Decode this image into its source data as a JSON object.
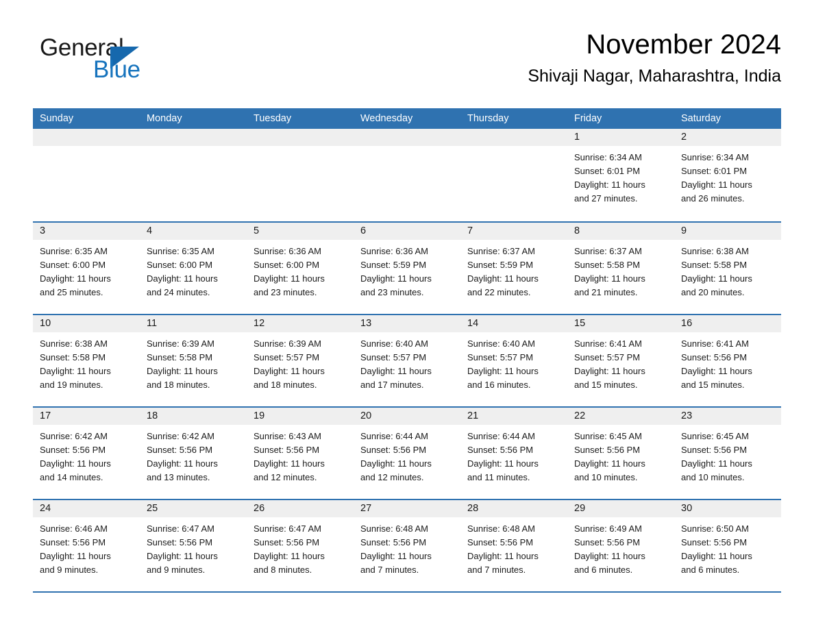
{
  "brand": {
    "name_part1": "General",
    "name_part2": "Blue",
    "accent_color": "#1668ad",
    "triangle_icon": "brand-triangle-icon"
  },
  "header": {
    "month_title": "November 2024",
    "location": "Shivaji Nagar, Maharashtra, India"
  },
  "calendar": {
    "header_bg": "#2f72b0",
    "day_band_bg": "#efefef",
    "weekday_headers": [
      "Sunday",
      "Monday",
      "Tuesday",
      "Wednesday",
      "Thursday",
      "Friday",
      "Saturday"
    ],
    "weeks": [
      [
        {
          "day": "",
          "empty": true,
          "sunrise": "",
          "sunset": "",
          "daylight_1": "",
          "daylight_2": ""
        },
        {
          "day": "",
          "empty": true,
          "sunrise": "",
          "sunset": "",
          "daylight_1": "",
          "daylight_2": ""
        },
        {
          "day": "",
          "empty": true,
          "sunrise": "",
          "sunset": "",
          "daylight_1": "",
          "daylight_2": ""
        },
        {
          "day": "",
          "empty": true,
          "sunrise": "",
          "sunset": "",
          "daylight_1": "",
          "daylight_2": ""
        },
        {
          "day": "",
          "empty": true,
          "sunrise": "",
          "sunset": "",
          "daylight_1": "",
          "daylight_2": ""
        },
        {
          "day": "1",
          "empty": false,
          "sunrise": "Sunrise: 6:34 AM",
          "sunset": "Sunset: 6:01 PM",
          "daylight_1": "Daylight: 11 hours",
          "daylight_2": "and 27 minutes."
        },
        {
          "day": "2",
          "empty": false,
          "sunrise": "Sunrise: 6:34 AM",
          "sunset": "Sunset: 6:01 PM",
          "daylight_1": "Daylight: 11 hours",
          "daylight_2": "and 26 minutes."
        }
      ],
      [
        {
          "day": "3",
          "empty": false,
          "sunrise": "Sunrise: 6:35 AM",
          "sunset": "Sunset: 6:00 PM",
          "daylight_1": "Daylight: 11 hours",
          "daylight_2": "and 25 minutes."
        },
        {
          "day": "4",
          "empty": false,
          "sunrise": "Sunrise: 6:35 AM",
          "sunset": "Sunset: 6:00 PM",
          "daylight_1": "Daylight: 11 hours",
          "daylight_2": "and 24 minutes."
        },
        {
          "day": "5",
          "empty": false,
          "sunrise": "Sunrise: 6:36 AM",
          "sunset": "Sunset: 6:00 PM",
          "daylight_1": "Daylight: 11 hours",
          "daylight_2": "and 23 minutes."
        },
        {
          "day": "6",
          "empty": false,
          "sunrise": "Sunrise: 6:36 AM",
          "sunset": "Sunset: 5:59 PM",
          "daylight_1": "Daylight: 11 hours",
          "daylight_2": "and 23 minutes."
        },
        {
          "day": "7",
          "empty": false,
          "sunrise": "Sunrise: 6:37 AM",
          "sunset": "Sunset: 5:59 PM",
          "daylight_1": "Daylight: 11 hours",
          "daylight_2": "and 22 minutes."
        },
        {
          "day": "8",
          "empty": false,
          "sunrise": "Sunrise: 6:37 AM",
          "sunset": "Sunset: 5:58 PM",
          "daylight_1": "Daylight: 11 hours",
          "daylight_2": "and 21 minutes."
        },
        {
          "day": "9",
          "empty": false,
          "sunrise": "Sunrise: 6:38 AM",
          "sunset": "Sunset: 5:58 PM",
          "daylight_1": "Daylight: 11 hours",
          "daylight_2": "and 20 minutes."
        }
      ],
      [
        {
          "day": "10",
          "empty": false,
          "sunrise": "Sunrise: 6:38 AM",
          "sunset": "Sunset: 5:58 PM",
          "daylight_1": "Daylight: 11 hours",
          "daylight_2": "and 19 minutes."
        },
        {
          "day": "11",
          "empty": false,
          "sunrise": "Sunrise: 6:39 AM",
          "sunset": "Sunset: 5:58 PM",
          "daylight_1": "Daylight: 11 hours",
          "daylight_2": "and 18 minutes."
        },
        {
          "day": "12",
          "empty": false,
          "sunrise": "Sunrise: 6:39 AM",
          "sunset": "Sunset: 5:57 PM",
          "daylight_1": "Daylight: 11 hours",
          "daylight_2": "and 18 minutes."
        },
        {
          "day": "13",
          "empty": false,
          "sunrise": "Sunrise: 6:40 AM",
          "sunset": "Sunset: 5:57 PM",
          "daylight_1": "Daylight: 11 hours",
          "daylight_2": "and 17 minutes."
        },
        {
          "day": "14",
          "empty": false,
          "sunrise": "Sunrise: 6:40 AM",
          "sunset": "Sunset: 5:57 PM",
          "daylight_1": "Daylight: 11 hours",
          "daylight_2": "and 16 minutes."
        },
        {
          "day": "15",
          "empty": false,
          "sunrise": "Sunrise: 6:41 AM",
          "sunset": "Sunset: 5:57 PM",
          "daylight_1": "Daylight: 11 hours",
          "daylight_2": "and 15 minutes."
        },
        {
          "day": "16",
          "empty": false,
          "sunrise": "Sunrise: 6:41 AM",
          "sunset": "Sunset: 5:56 PM",
          "daylight_1": "Daylight: 11 hours",
          "daylight_2": "and 15 minutes."
        }
      ],
      [
        {
          "day": "17",
          "empty": false,
          "sunrise": "Sunrise: 6:42 AM",
          "sunset": "Sunset: 5:56 PM",
          "daylight_1": "Daylight: 11 hours",
          "daylight_2": "and 14 minutes."
        },
        {
          "day": "18",
          "empty": false,
          "sunrise": "Sunrise: 6:42 AM",
          "sunset": "Sunset: 5:56 PM",
          "daylight_1": "Daylight: 11 hours",
          "daylight_2": "and 13 minutes."
        },
        {
          "day": "19",
          "empty": false,
          "sunrise": "Sunrise: 6:43 AM",
          "sunset": "Sunset: 5:56 PM",
          "daylight_1": "Daylight: 11 hours",
          "daylight_2": "and 12 minutes."
        },
        {
          "day": "20",
          "empty": false,
          "sunrise": "Sunrise: 6:44 AM",
          "sunset": "Sunset: 5:56 PM",
          "daylight_1": "Daylight: 11 hours",
          "daylight_2": "and 12 minutes."
        },
        {
          "day": "21",
          "empty": false,
          "sunrise": "Sunrise: 6:44 AM",
          "sunset": "Sunset: 5:56 PM",
          "daylight_1": "Daylight: 11 hours",
          "daylight_2": "and 11 minutes."
        },
        {
          "day": "22",
          "empty": false,
          "sunrise": "Sunrise: 6:45 AM",
          "sunset": "Sunset: 5:56 PM",
          "daylight_1": "Daylight: 11 hours",
          "daylight_2": "and 10 minutes."
        },
        {
          "day": "23",
          "empty": false,
          "sunrise": "Sunrise: 6:45 AM",
          "sunset": "Sunset: 5:56 PM",
          "daylight_1": "Daylight: 11 hours",
          "daylight_2": "and 10 minutes."
        }
      ],
      [
        {
          "day": "24",
          "empty": false,
          "sunrise": "Sunrise: 6:46 AM",
          "sunset": "Sunset: 5:56 PM",
          "daylight_1": "Daylight: 11 hours",
          "daylight_2": "and 9 minutes."
        },
        {
          "day": "25",
          "empty": false,
          "sunrise": "Sunrise: 6:47 AM",
          "sunset": "Sunset: 5:56 PM",
          "daylight_1": "Daylight: 11 hours",
          "daylight_2": "and 9 minutes."
        },
        {
          "day": "26",
          "empty": false,
          "sunrise": "Sunrise: 6:47 AM",
          "sunset": "Sunset: 5:56 PM",
          "daylight_1": "Daylight: 11 hours",
          "daylight_2": "and 8 minutes."
        },
        {
          "day": "27",
          "empty": false,
          "sunrise": "Sunrise: 6:48 AM",
          "sunset": "Sunset: 5:56 PM",
          "daylight_1": "Daylight: 11 hours",
          "daylight_2": "and 7 minutes."
        },
        {
          "day": "28",
          "empty": false,
          "sunrise": "Sunrise: 6:48 AM",
          "sunset": "Sunset: 5:56 PM",
          "daylight_1": "Daylight: 11 hours",
          "daylight_2": "and 7 minutes."
        },
        {
          "day": "29",
          "empty": false,
          "sunrise": "Sunrise: 6:49 AM",
          "sunset": "Sunset: 5:56 PM",
          "daylight_1": "Daylight: 11 hours",
          "daylight_2": "and 6 minutes."
        },
        {
          "day": "30",
          "empty": false,
          "sunrise": "Sunrise: 6:50 AM",
          "sunset": "Sunset: 5:56 PM",
          "daylight_1": "Daylight: 11 hours",
          "daylight_2": "and 6 minutes."
        }
      ]
    ]
  }
}
